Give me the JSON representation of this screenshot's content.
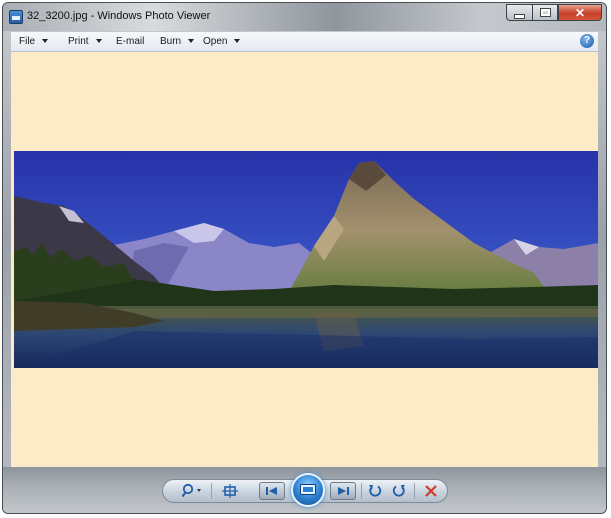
{
  "window": {
    "title": "32_3200.jpg - Windows Photo Viewer",
    "close_glyph": "✕"
  },
  "menu": {
    "items": [
      {
        "label": "File",
        "dropdown": true
      },
      {
        "label": "Print",
        "dropdown": true
      },
      {
        "label": "E-mail",
        "dropdown": false
      },
      {
        "label": "Burn",
        "dropdown": true
      },
      {
        "label": "Open",
        "dropdown": true
      }
    ],
    "help_glyph": "?"
  },
  "toolbar": {
    "icons": [
      "zoom-icon",
      "actual-size-icon",
      "previous-icon",
      "slideshow-icon",
      "next-icon",
      "rotate-counterclockwise-icon",
      "rotate-clockwise-icon",
      "delete-icon"
    ]
  },
  "colors": {
    "viewer_background": "#fdebc8",
    "accent_blue": "#2b7fd0",
    "delete_red": "#d03a2a"
  }
}
